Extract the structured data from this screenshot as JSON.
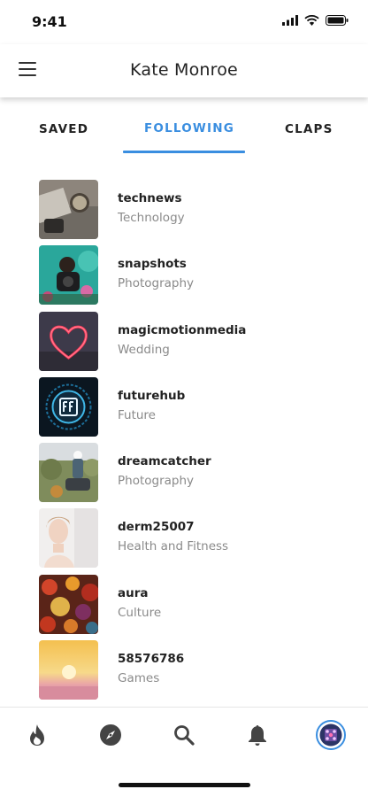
{
  "status_bar": {
    "time": "9:41"
  },
  "header": {
    "title": "Kate Monroe"
  },
  "tabs": [
    {
      "label": "SAVED",
      "active": false
    },
    {
      "label": "FOLLOWING",
      "active": true
    },
    {
      "label": "CLAPS",
      "active": false
    }
  ],
  "following": [
    {
      "name": "technews",
      "category": "Technology"
    },
    {
      "name": "snapshots",
      "category": "Photography"
    },
    {
      "name": "magicmotionmedia",
      "category": "Wedding"
    },
    {
      "name": "futurehub",
      "category": "Future"
    },
    {
      "name": "dreamcatcher",
      "category": "Photography"
    },
    {
      "name": "derm25007",
      "category": "Health and Fitness"
    },
    {
      "name": "aura",
      "category": "Culture"
    },
    {
      "name": "58576786",
      "category": "Games"
    }
  ],
  "bottom_nav": [
    {
      "icon": "flame-icon"
    },
    {
      "icon": "compass-icon"
    },
    {
      "icon": "search-icon"
    },
    {
      "icon": "bell-icon"
    },
    {
      "icon": "profile-avatar-icon",
      "active": true
    }
  ],
  "colors": {
    "accent": "#3a8ee0",
    "text": "#222222",
    "muted": "#8a8a8a"
  }
}
